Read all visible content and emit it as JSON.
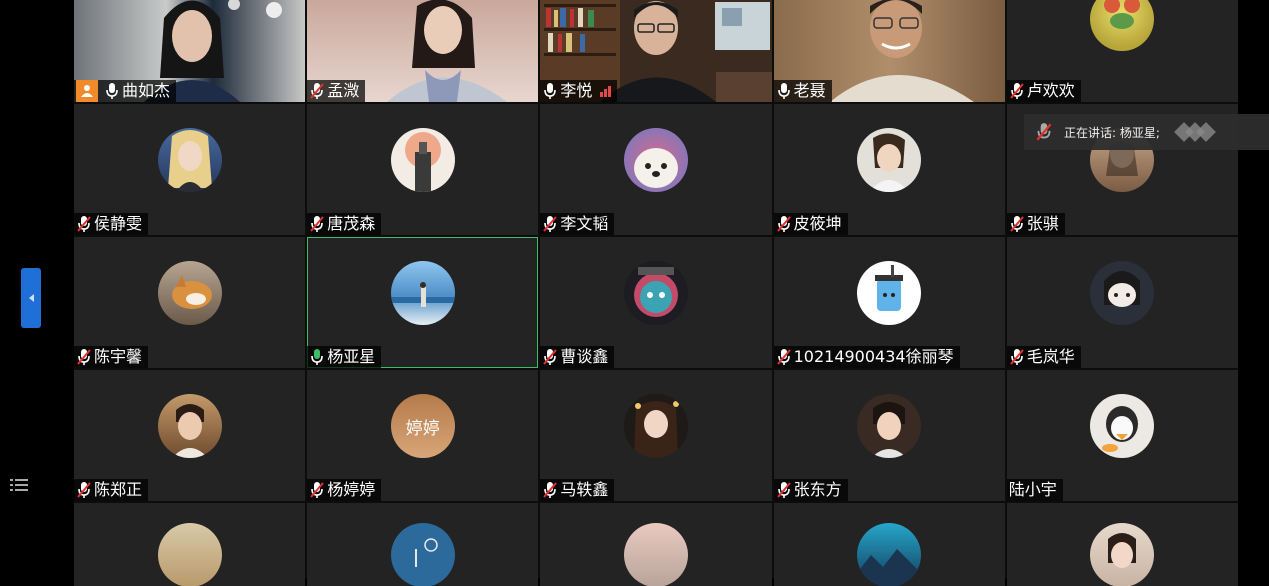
{
  "speaking_toast": {
    "label": "正在讲话: 杨亚星;"
  },
  "colors": {
    "active_border": "#3bbf62",
    "host_badge": "#f08a2b",
    "side_tab": "#1f6fd6"
  },
  "tiles": [
    {
      "name": "曲如杰",
      "mic": "on",
      "video": true,
      "host": true
    },
    {
      "name": "孟溦",
      "mic": "muted",
      "video": true
    },
    {
      "name": "李悦",
      "mic": "on",
      "video": true,
      "signal": "weak"
    },
    {
      "name": "老聂",
      "mic": "on",
      "video": true
    },
    {
      "name": "卢欢欢",
      "mic": "muted",
      "video": false
    },
    {
      "name": "侯静雯",
      "mic": "muted"
    },
    {
      "name": "唐茂森",
      "mic": "muted"
    },
    {
      "name": "李文韬",
      "mic": "muted"
    },
    {
      "name": "皮筱坤",
      "mic": "muted"
    },
    {
      "name": "张骐",
      "mic": "muted"
    },
    {
      "name": "陈宇馨",
      "mic": "muted"
    },
    {
      "name": "杨亚星",
      "mic": "speaking",
      "active": true
    },
    {
      "name": "曹谈鑫",
      "mic": "muted"
    },
    {
      "name": "10214900434徐丽琴",
      "mic": "muted"
    },
    {
      "name": "毛岚华",
      "mic": "muted"
    },
    {
      "name": "陈郑正",
      "mic": "muted"
    },
    {
      "name": "杨婷婷",
      "mic": "muted",
      "avatar_text": "婷婷"
    },
    {
      "name": "马轶鑫",
      "mic": "muted"
    },
    {
      "name": "张东方",
      "mic": "muted"
    },
    {
      "name": "陆小宇",
      "mic": "none"
    },
    {
      "name": "",
      "mic": "none"
    },
    {
      "name": "",
      "mic": "none"
    },
    {
      "name": "",
      "mic": "none"
    },
    {
      "name": "",
      "mic": "none"
    },
    {
      "name": "",
      "mic": "none"
    }
  ]
}
